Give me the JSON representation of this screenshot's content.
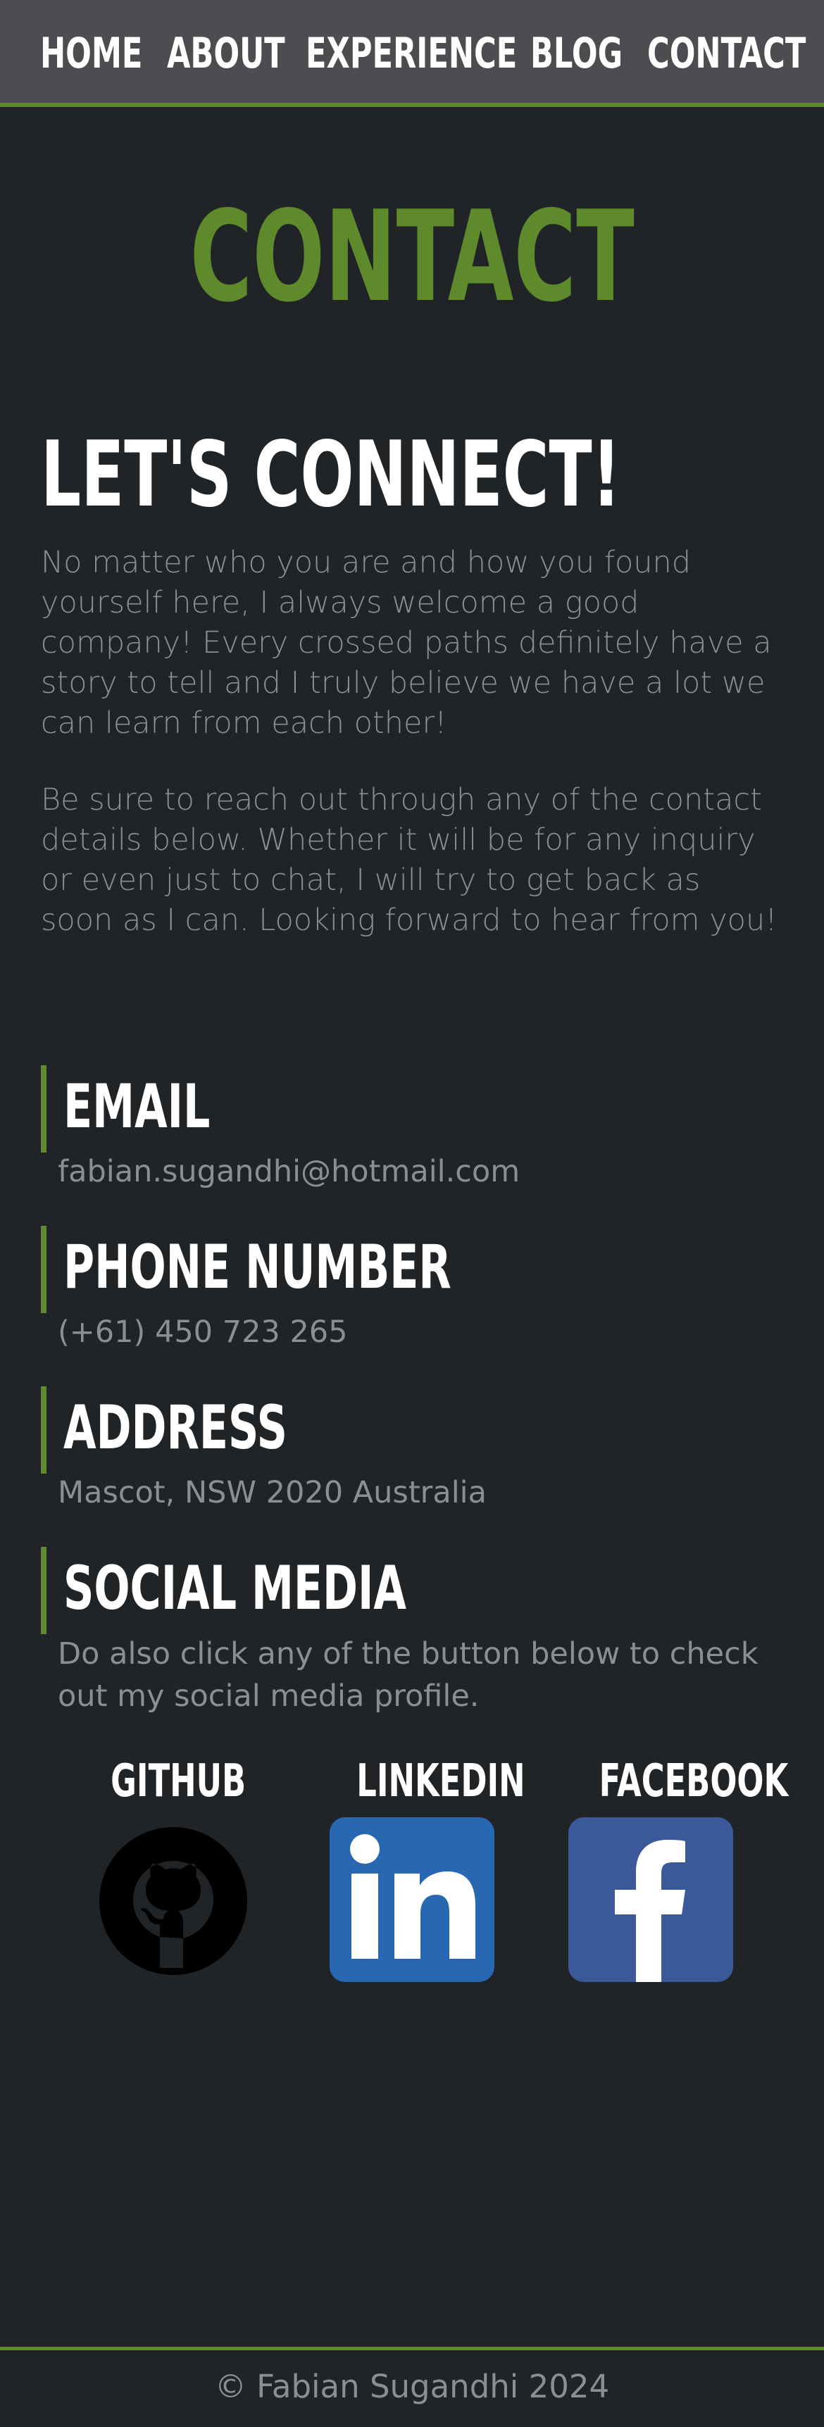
{
  "nav": {
    "home": "HOME",
    "about": "ABOUT",
    "experience": "EXPERIENCE",
    "blog": "BLOG",
    "contact": "CONTACT"
  },
  "page_title": "CONTACT",
  "intro": {
    "heading": "LET'S CONNECT!",
    "paragraph1": "No matter who you are and how you found yourself here, I always welcome a good company! Every crossed paths definitely have a story to tell and I truly believe we have a lot we can learn from each other!",
    "paragraph2": "Be sure to reach out through any of the contact details below. Whether it will be for any inquiry or even just to chat, I will try to get back as soon as I can. Looking forward to hear from you!"
  },
  "contact": {
    "email": {
      "title": "EMAIL",
      "value": "fabian.sugandhi@hotmail.com"
    },
    "phone": {
      "title": "PHONE NUMBER",
      "value": "(+61) 450 723 265"
    },
    "address": {
      "title": "ADDRESS",
      "value": "Mascot, NSW 2020 Australia"
    },
    "social": {
      "title": "SOCIAL MEDIA",
      "value": "Do also click any of the button below to check out my social media profile."
    }
  },
  "socials": {
    "github": {
      "label": "GITHUB",
      "icon": "github-icon"
    },
    "linkedin": {
      "label": "LINKEDIN",
      "icon": "linkedin-icon"
    },
    "facebook": {
      "label": "FACEBOOK",
      "icon": "facebook-icon"
    }
  },
  "footer": {
    "copyright": "© Fabian Sugandhi 2024"
  },
  "colors": {
    "background": "#212427",
    "nav_background": "#4b4d51",
    "accent": "#5e8a2c",
    "body_text": "#8c8e91",
    "linkedin": "#2867b2",
    "facebook": "#3b5998"
  }
}
